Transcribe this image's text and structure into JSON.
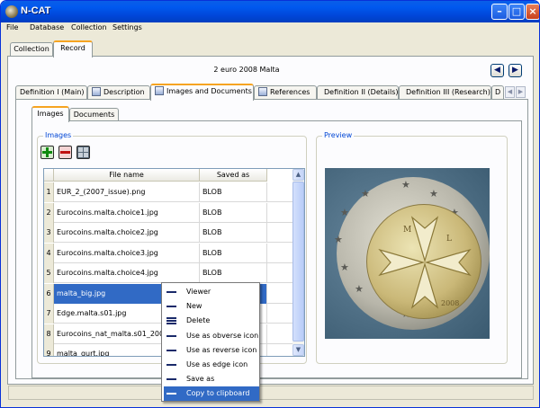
{
  "window": {
    "title": "N-CAT"
  },
  "menubar": [
    "File",
    "Database",
    "Collection",
    "Settings"
  ],
  "main_tabs": [
    {
      "label": "Collection",
      "selected": false
    },
    {
      "label": "Record",
      "selected": true
    }
  ],
  "record": {
    "title": "2 euro 2008 Malta"
  },
  "detail_tabs": [
    {
      "label": "Definition I (Main)",
      "selected": false
    },
    {
      "label": "Description",
      "selected": false
    },
    {
      "label": "Images and Documents",
      "selected": true
    },
    {
      "label": "References",
      "selected": false
    },
    {
      "label": "Definition II (Details)",
      "selected": false
    },
    {
      "label": "Definition III (Research)",
      "selected": false
    },
    {
      "label": "D",
      "selected": false
    }
  ],
  "inner_tabs": [
    {
      "label": "Images",
      "selected": true
    },
    {
      "label": "Documents",
      "selected": false
    }
  ],
  "images_group": {
    "label": "Images",
    "buttons": [
      {
        "name": "add",
        "icon": "plus-icon"
      },
      {
        "name": "remove",
        "icon": "minus-icon"
      },
      {
        "name": "edit",
        "icon": "grid-icon"
      }
    ],
    "columns": [
      "File name",
      "Saved as"
    ],
    "rows": [
      {
        "n": "1",
        "file": "EUR_2_(2007_issue).png",
        "saved": "BLOB"
      },
      {
        "n": "2",
        "file": "Eurocoins.malta.choice1.jpg",
        "saved": "BLOB"
      },
      {
        "n": "3",
        "file": "Eurocoins.malta.choice2.jpg",
        "saved": "BLOB"
      },
      {
        "n": "4",
        "file": "Eurocoins.malta.choice3.jpg",
        "saved": "BLOB"
      },
      {
        "n": "5",
        "file": "Eurocoins.malta.choice4.jpg",
        "saved": "BLOB"
      },
      {
        "n": "6",
        "file": "malta_big.jpg",
        "saved": ""
      },
      {
        "n": "7",
        "file": "Edge.malta.s01.jpg",
        "saved": ""
      },
      {
        "n": "8",
        "file": "Eurocoins_nat_malta.s01_200.jpg",
        "saved": ""
      },
      {
        "n": "9",
        "file": "malta_gurt.jpg",
        "saved": ""
      }
    ],
    "selected_row": 6
  },
  "preview_group": {
    "label": "Preview"
  },
  "context_menu": [
    {
      "label": "Viewer",
      "icon": "dash-icon"
    },
    {
      "label": "New",
      "icon": "dash-icon"
    },
    {
      "label": "Delete",
      "icon": "list-icon"
    },
    {
      "label": "Use as obverse icon",
      "icon": "dash-icon"
    },
    {
      "label": "Use as reverse icon",
      "icon": "dash-icon"
    },
    {
      "label": "Use as edge icon",
      "icon": "dash-icon"
    },
    {
      "label": "Save as",
      "icon": "dash-icon"
    },
    {
      "label": "Copy to clipboard",
      "icon": "dash-icon",
      "highlighted": true
    }
  ],
  "colors": {
    "accent": "#316ac5",
    "titlebar": "#0058ee",
    "tab_highlight": "#f6a421",
    "group_label": "#0046d5"
  }
}
